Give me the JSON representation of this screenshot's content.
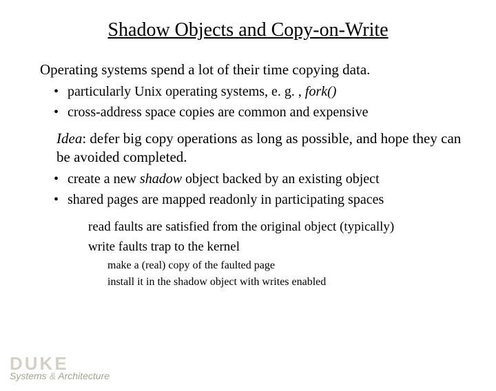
{
  "title": "Shadow Objects and Copy-on-Write",
  "p1": "Operating systems spend a lot of their time copying data.",
  "b1a_prefix": "particularly Unix operating systems, e. g. , ",
  "b1a_italic": "fork()",
  "b1b": "cross-address space copies are common and expensive",
  "p2_idea": "Idea",
  "p2_rest": ": defer big copy operations as long as possible, and hope they can be avoided completed.",
  "b2a_prefix": "create a new ",
  "b2a_italic": "shadow",
  "b2a_suffix": " object backed by an existing object",
  "b2b": "shared pages are mapped readonly in participating spaces",
  "s1": "read faults are satisfied from the original object (typically)",
  "s2": "write faults trap to the kernel",
  "s2a": "make a (real) copy of the faulted page",
  "s2b": "install it in the shadow object with writes enabled",
  "footer_duke": "DUKE",
  "footer_sub_a": "Systems",
  "footer_sub_amp": " & ",
  "footer_sub_b": "Architecture"
}
